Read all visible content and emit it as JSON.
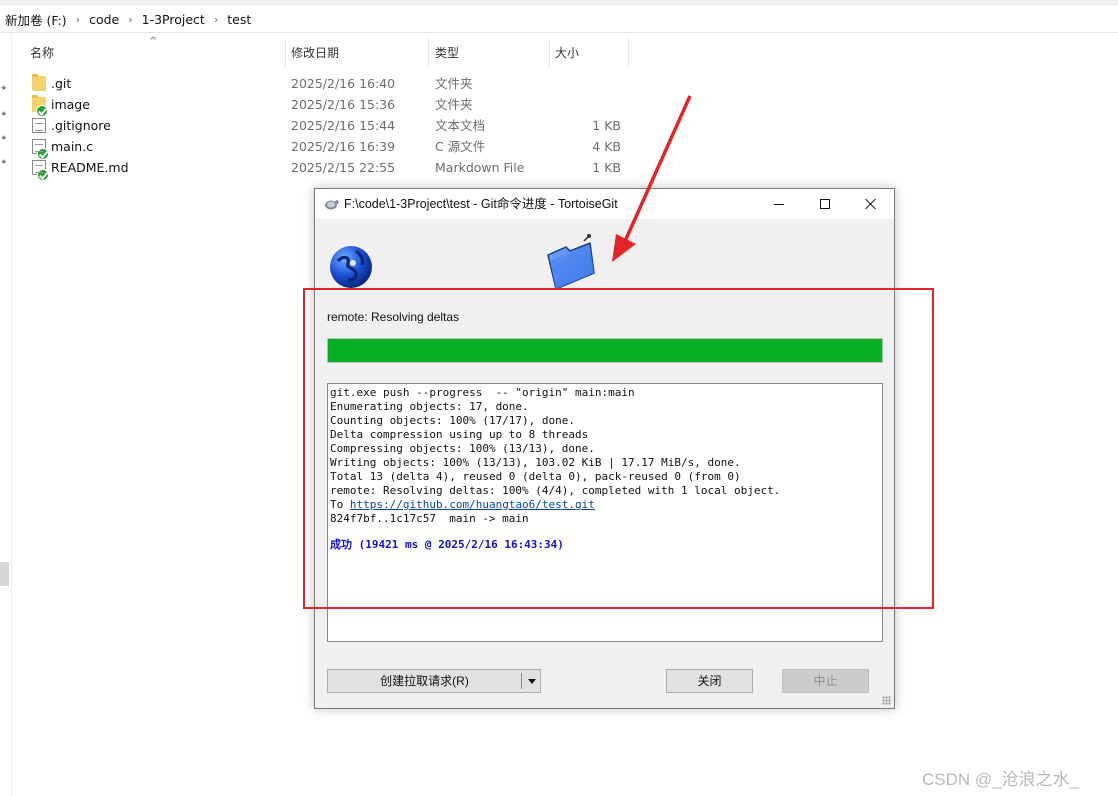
{
  "explorer": {
    "breadcrumbs": [
      "新加卷 (F:)",
      "code",
      "1-3Project",
      "test"
    ],
    "columns": {
      "name": "名称",
      "modified": "修改日期",
      "type": "类型",
      "size": "大小"
    },
    "files": [
      {
        "name": ".git",
        "modified": "2025/2/16 16:40",
        "type": "文件夹",
        "size": "",
        "icon": "folder-icon",
        "badge": ""
      },
      {
        "name": "image",
        "modified": "2025/2/16 15:36",
        "type": "文件夹",
        "size": "",
        "icon": "folder-icon",
        "badge": "git-ok-badge-icon"
      },
      {
        "name": ".gitignore",
        "modified": "2025/2/16 15:44",
        "type": "文本文档",
        "size": "1 KB",
        "icon": "text-file-icon",
        "badge": ""
      },
      {
        "name": "main.c",
        "modified": "2025/2/16 16:39",
        "type": "C 源文件",
        "size": "4 KB",
        "icon": "c-file-icon",
        "badge": "git-ok-badge-icon"
      },
      {
        "name": "README.md",
        "modified": "2025/2/15 22:55",
        "type": "Markdown File",
        "size": "1 KB",
        "icon": "markdown-file-icon",
        "badge": "git-ok-badge-icon"
      }
    ]
  },
  "dialog": {
    "title": "F:\\code\\1-3Project\\test - Git命令进度 - TortoiseGit",
    "status": "remote: Resolving deltas",
    "progress_percent": 100,
    "progress_color": "#06b025",
    "log_lines": [
      "git.exe push --progress  -- \"origin\" main:main",
      "Enumerating objects: 17, done.",
      "Counting objects: 100% (17/17), done.",
      "Delta compression using up to 8 threads",
      "Compressing objects: 100% (13/13), done.",
      "Writing objects: 100% (13/13), 103.02 KiB | 17.17 MiB/s, done.",
      "Total 13 (delta 4), reused 0 (delta 0), pack-reused 0 (from 0)",
      "remote: Resolving deltas: 100% (4/4), completed with 1 local object."
    ],
    "to_prefix": "To ",
    "to_url": "https://github.com/huangtao6/test.git",
    "ref_update": "824f7bf..1c17c57  main -> main",
    "success_line": "成功 (19421 ms @ 2025/2/16 16:43:34)",
    "buttons": {
      "create_pr": "创建拉取请求(R)",
      "close": "关闭",
      "abort": "中止"
    }
  },
  "watermark": "CSDN @_沧浪之水_",
  "annotation_color": "#e3242b"
}
